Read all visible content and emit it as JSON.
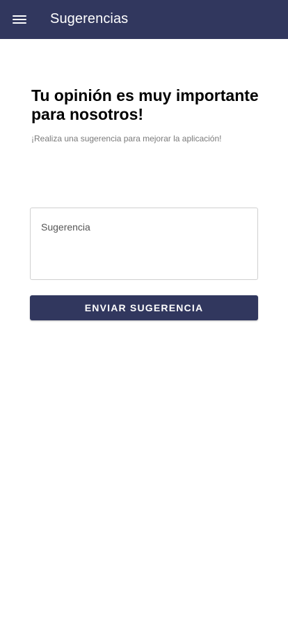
{
  "app_bar": {
    "menu_icon": "hamburger-menu-icon",
    "title": "Sugerencias",
    "background_color": "#31375e"
  },
  "content": {
    "heading": "Tu opinión es muy importante para nosotros!",
    "subheading": "¡Realiza una sugerencia para mejorar la aplicación!",
    "suggestion_field": {
      "placeholder": "Sugerencia",
      "value": ""
    },
    "submit_label": "ENVIAR SUGERENCIA"
  }
}
